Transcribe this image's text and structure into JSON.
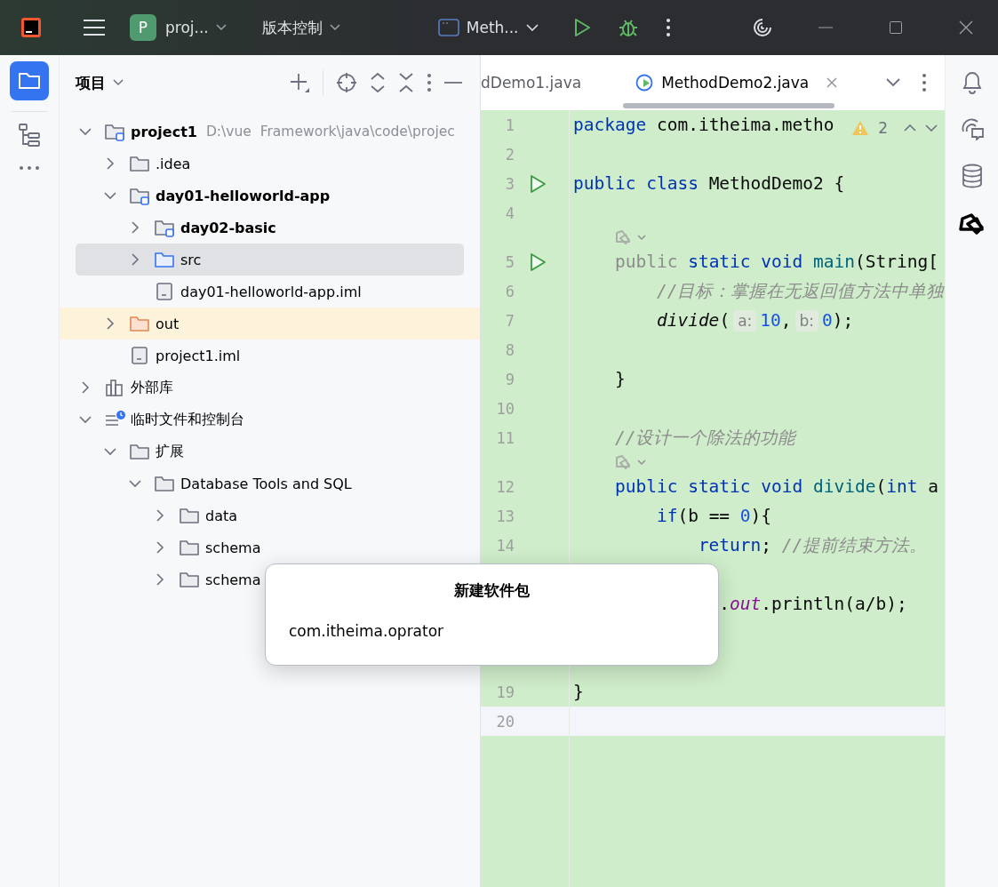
{
  "titlebar": {
    "project_badge": "P",
    "project": "proj...",
    "vcs": "版本控制",
    "run_config": "Meth..."
  },
  "project_panel": {
    "title": "项目"
  },
  "tree": [
    {
      "label": "project1",
      "kind": "module",
      "path": "D:\\vue  Framework\\java\\code\\projec",
      "expanded": true,
      "selected": false,
      "children": [
        {
          "label": ".idea",
          "kind": "folder",
          "expanded": false,
          "selected": false
        },
        {
          "label": "day01-helloworld-app",
          "kind": "module",
          "expanded": true,
          "selected": false,
          "children": [
            {
              "label": "day02-basic",
              "kind": "module",
              "expanded": false,
              "selected": false
            },
            {
              "label": "src",
              "kind": "source",
              "expanded": false,
              "selected": true
            },
            {
              "label": "day01-helloworld-app.iml",
              "kind": "file",
              "selected": false
            }
          ]
        },
        {
          "label": "out",
          "kind": "excluded",
          "expanded": false,
          "selected": false
        },
        {
          "label": "project1.iml",
          "kind": "file",
          "selected": false
        }
      ]
    },
    {
      "label": "外部库",
      "kind": "library",
      "expanded": false,
      "selected": false
    },
    {
      "label": "临时文件和控制台",
      "kind": "scratch",
      "expanded": true,
      "selected": false,
      "children": [
        {
          "label": "扩展",
          "kind": "folder",
          "expanded": true,
          "selected": false,
          "children": [
            {
              "label": "Database Tools and SQL",
              "kind": "folder",
              "expanded": true,
              "selected": false,
              "children": [
                {
                  "label": "data",
                  "kind": "folder",
                  "expanded": false,
                  "selected": false
                },
                {
                  "label": "schema",
                  "kind": "folder",
                  "expanded": false,
                  "selected": false
                },
                {
                  "label": "schema",
                  "kind": "folder",
                  "expanded": false,
                  "selected": false
                }
              ]
            }
          ]
        }
      ]
    }
  ],
  "tabs": [
    {
      "label": "dDemo1.java",
      "selected": false
    },
    {
      "label": "MethodDemo2.java",
      "selected": true
    }
  ],
  "warnings": "2",
  "lines": [
    {
      "kind": "code",
      "number": "1",
      "current": false,
      "tokens": [
        {
          "kind": "kw",
          "s": "package"
        },
        {
          "kind": "plain",
          "s": " com.itheima.metho"
        }
      ]
    },
    {
      "kind": "code",
      "number": "2",
      "current": false
    },
    {
      "kind": "code",
      "number": "3",
      "run": true,
      "current": false,
      "tokens": [
        {
          "kind": "kw",
          "s": "public class"
        },
        {
          "kind": "plain",
          "s": " MethodDemo2 {"
        }
      ]
    },
    {
      "kind": "code",
      "number": "4",
      "current": false
    },
    {
      "kind": "hint"
    },
    {
      "kind": "code",
      "number": "5",
      "run": true,
      "current": false,
      "tokens": [
        {
          "kind": "muted",
          "s": "    public"
        },
        {
          "kind": "kw",
          "s": " static void"
        },
        {
          "kind": "decl",
          "s": " main"
        },
        {
          "kind": "plain",
          "s": "(String["
        }
      ]
    },
    {
      "kind": "code",
      "number": "6",
      "current": false,
      "tokens": [
        {
          "kind": "comment",
          "s": "        //目标：掌握在无返回值方法中单独"
        }
      ]
    },
    {
      "kind": "code",
      "number": "7",
      "current": false,
      "tokens": [
        {
          "kind": "call",
          "s": "        divide"
        },
        {
          "kind": "plain",
          "s": "("
        },
        {
          "kind": "param",
          "s": "a:"
        },
        {
          "kind": "num",
          "s": "10"
        },
        {
          "kind": "plain",
          "s": ","
        },
        {
          "kind": "param",
          "s": "b:"
        },
        {
          "kind": "num",
          "s": "0"
        },
        {
          "kind": "plain",
          "s": ");"
        }
      ]
    },
    {
      "kind": "code",
      "number": "8",
      "current": false
    },
    {
      "kind": "code",
      "number": "9",
      "current": false,
      "tokens": [
        {
          "kind": "plain",
          "s": "    }"
        }
      ]
    },
    {
      "kind": "code",
      "number": "10",
      "current": false
    },
    {
      "kind": "code",
      "number": "11",
      "current": false,
      "tokens": [
        {
          "kind": "comment",
          "s": "    //设计一个除法的功能"
        }
      ]
    },
    {
      "kind": "hint"
    },
    {
      "kind": "code",
      "number": "12",
      "current": false,
      "tokens": [
        {
          "kind": "kw",
          "s": "    public static void"
        },
        {
          "kind": "decl",
          "s": " divide"
        },
        {
          "kind": "plain",
          "s": "("
        },
        {
          "kind": "kw",
          "s": "int"
        },
        {
          "kind": "plain",
          "s": " a"
        }
      ]
    },
    {
      "kind": "code",
      "number": "13",
      "current": false,
      "tokens": [
        {
          "kind": "kw",
          "s": "        if"
        },
        {
          "kind": "plain",
          "s": "(b == "
        },
        {
          "kind": "num",
          "s": "0"
        },
        {
          "kind": "plain",
          "s": "){"
        }
      ]
    },
    {
      "kind": "code",
      "number": "14",
      "current": false,
      "tokens": [
        {
          "kind": "kw",
          "s": "            return"
        },
        {
          "kind": "plain",
          "s": "; "
        },
        {
          "kind": "comment",
          "s": "//提前结束方法。"
        }
      ]
    },
    {
      "kind": "covered"
    },
    {
      "kind": "code",
      "current": false,
      "tokens": [
        {
          "kind": "plain",
          "s": "              ."
        },
        {
          "kind": "field",
          "s": "out"
        },
        {
          "kind": "plain",
          "s": ".println(a/b);"
        }
      ]
    },
    {
      "kind": "covered"
    },
    {
      "kind": "covered"
    },
    {
      "kind": "code",
      "number": "19",
      "current": false,
      "tokens": [
        {
          "kind": "plain",
          "s": "}"
        }
      ]
    },
    {
      "kind": "code",
      "number": "20",
      "current": true
    }
  ],
  "dialog": {
    "title": "新建软件包",
    "value": "com.itheima.oprator"
  }
}
